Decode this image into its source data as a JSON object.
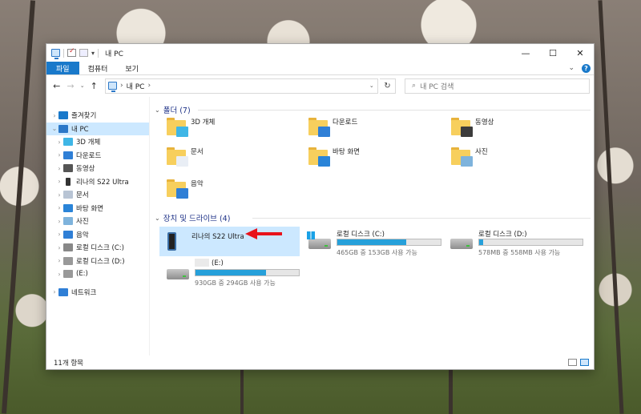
{
  "window": {
    "title": "내 PC",
    "minimize": "—",
    "maximize": "☐",
    "close": "✕"
  },
  "ribbon": {
    "tabs": [
      "파일",
      "컴퓨터",
      "보기"
    ],
    "expand_glyph": "⌄",
    "help_glyph": "?"
  },
  "address": {
    "back": "←",
    "forward": "→",
    "recent": "⌄",
    "up": "↑",
    "path": "내 PC",
    "path_sep": "›",
    "dropdown": "⌄",
    "refresh": "↻",
    "search_placeholder": "내 PC 검색",
    "search_glyph": "⌕"
  },
  "nav": {
    "items": [
      {
        "label": "즐겨찾기",
        "icon": "star-icon",
        "level": 0,
        "expander": "›"
      },
      {
        "label": "내 PC",
        "icon": "computer-icon",
        "level": 0,
        "expander": "⌄",
        "selected": true
      },
      {
        "label": "3D 개체",
        "icon": "3d-objects-icon",
        "level": 1,
        "expander": "›"
      },
      {
        "label": "다운로드",
        "icon": "download-icon",
        "level": 1,
        "expander": "›"
      },
      {
        "label": "동영상",
        "icon": "video-icon",
        "level": 1,
        "expander": "›"
      },
      {
        "label": "리나의 S22 Ultra",
        "icon": "phone-icon",
        "level": 1,
        "expander": "›"
      },
      {
        "label": "문서",
        "icon": "document-icon",
        "level": 1,
        "expander": "›"
      },
      {
        "label": "바탕 화면",
        "icon": "desktop-icon",
        "level": 1,
        "expander": "›"
      },
      {
        "label": "사진",
        "icon": "pictures-icon",
        "level": 1,
        "expander": "›"
      },
      {
        "label": "음악",
        "icon": "music-icon",
        "level": 1,
        "expander": "›"
      },
      {
        "label": "로컬 디스크 (C:)",
        "icon": "windows-drive-icon",
        "level": 1,
        "expander": "›"
      },
      {
        "label": "로컬 디스크 (D:)",
        "icon": "drive-icon",
        "level": 1,
        "expander": "›"
      },
      {
        "label": "(E:)",
        "icon": "drive-icon",
        "level": 1,
        "expander": "›"
      },
      {
        "label": "네트워크",
        "icon": "network-icon",
        "level": 0,
        "expander": "›"
      }
    ]
  },
  "folders_section": {
    "title": "폴더 (7)",
    "items": [
      {
        "label": "3D 개체",
        "badge_color": "#3fb6e6"
      },
      {
        "label": "다운로드",
        "badge_color": "#2f7fd6"
      },
      {
        "label": "동영상",
        "badge_color": "#3c3c3c"
      },
      {
        "label": "문서",
        "badge_color": "#e9eef5"
      },
      {
        "label": "바탕 화면",
        "badge_color": "#2a84d8"
      },
      {
        "label": "사진",
        "badge_color": "#7eb3dc"
      },
      {
        "label": "음악",
        "badge_color": "#2f7fd6"
      }
    ]
  },
  "drives_section": {
    "title": "장치 및 드라이브 (4)",
    "phone": {
      "label": "리나의 S22 Ultra"
    },
    "drives": [
      {
        "label": "로컬 디스크 (C:)",
        "info": "465GB 중 153GB 사용 가능",
        "used_fraction": 0.67
      },
      {
        "label": "로컬 디스크 (D:)",
        "info": "578MB 중 558MB 사용 가능",
        "used_fraction": 0.035
      },
      {
        "label": "(E:)",
        "info": "930GB 중 294GB 사용 가능",
        "used_fraction": 0.68
      }
    ]
  },
  "status": {
    "count": "11개 항목"
  },
  "colors": {
    "accent": "#1979ca",
    "bar_fill": "#26a0da",
    "selection": "#cce8ff",
    "arrow": "#e8131b"
  }
}
